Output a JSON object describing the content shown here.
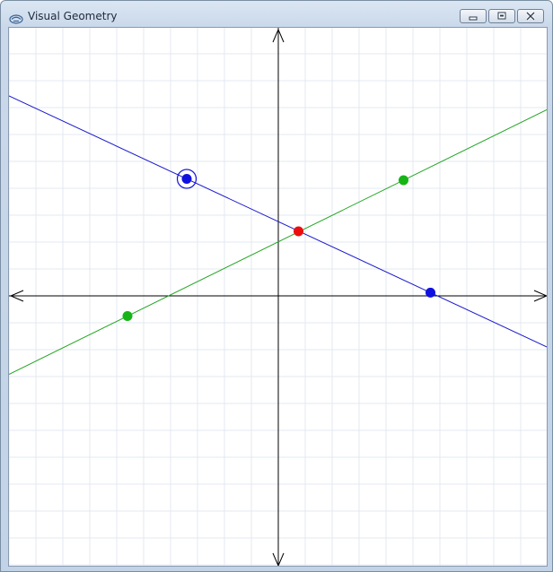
{
  "window": {
    "title": "Visual Geometry",
    "app_icon": "geometry-app-icon",
    "minimize_icon": "minimize-icon",
    "maximize_icon": "maximize-icon",
    "close_icon": "close-icon"
  },
  "colors": {
    "grid": "#e3e8f2",
    "axis": "#000000",
    "blue_line": "#1a1acc",
    "green_line": "#22a522",
    "blue_point": "#1010e0",
    "green_point": "#16b416",
    "intersection_point": "#ee0d0d",
    "client_bg": "#ffffff"
  },
  "scene": {
    "grid_spacing": 1,
    "x_range": [
      -10,
      10
    ],
    "y_range": [
      -10,
      10
    ],
    "blue_line": {
      "points": [
        [
          -3.4,
          4.35
        ],
        [
          5.65,
          0.12
        ]
      ],
      "selected_point_index": 0
    },
    "green_line": {
      "points": [
        [
          -5.6,
          -0.75
        ],
        [
          4.65,
          4.3
        ]
      ]
    },
    "intersection": [
      0.75,
      2.4
    ]
  }
}
